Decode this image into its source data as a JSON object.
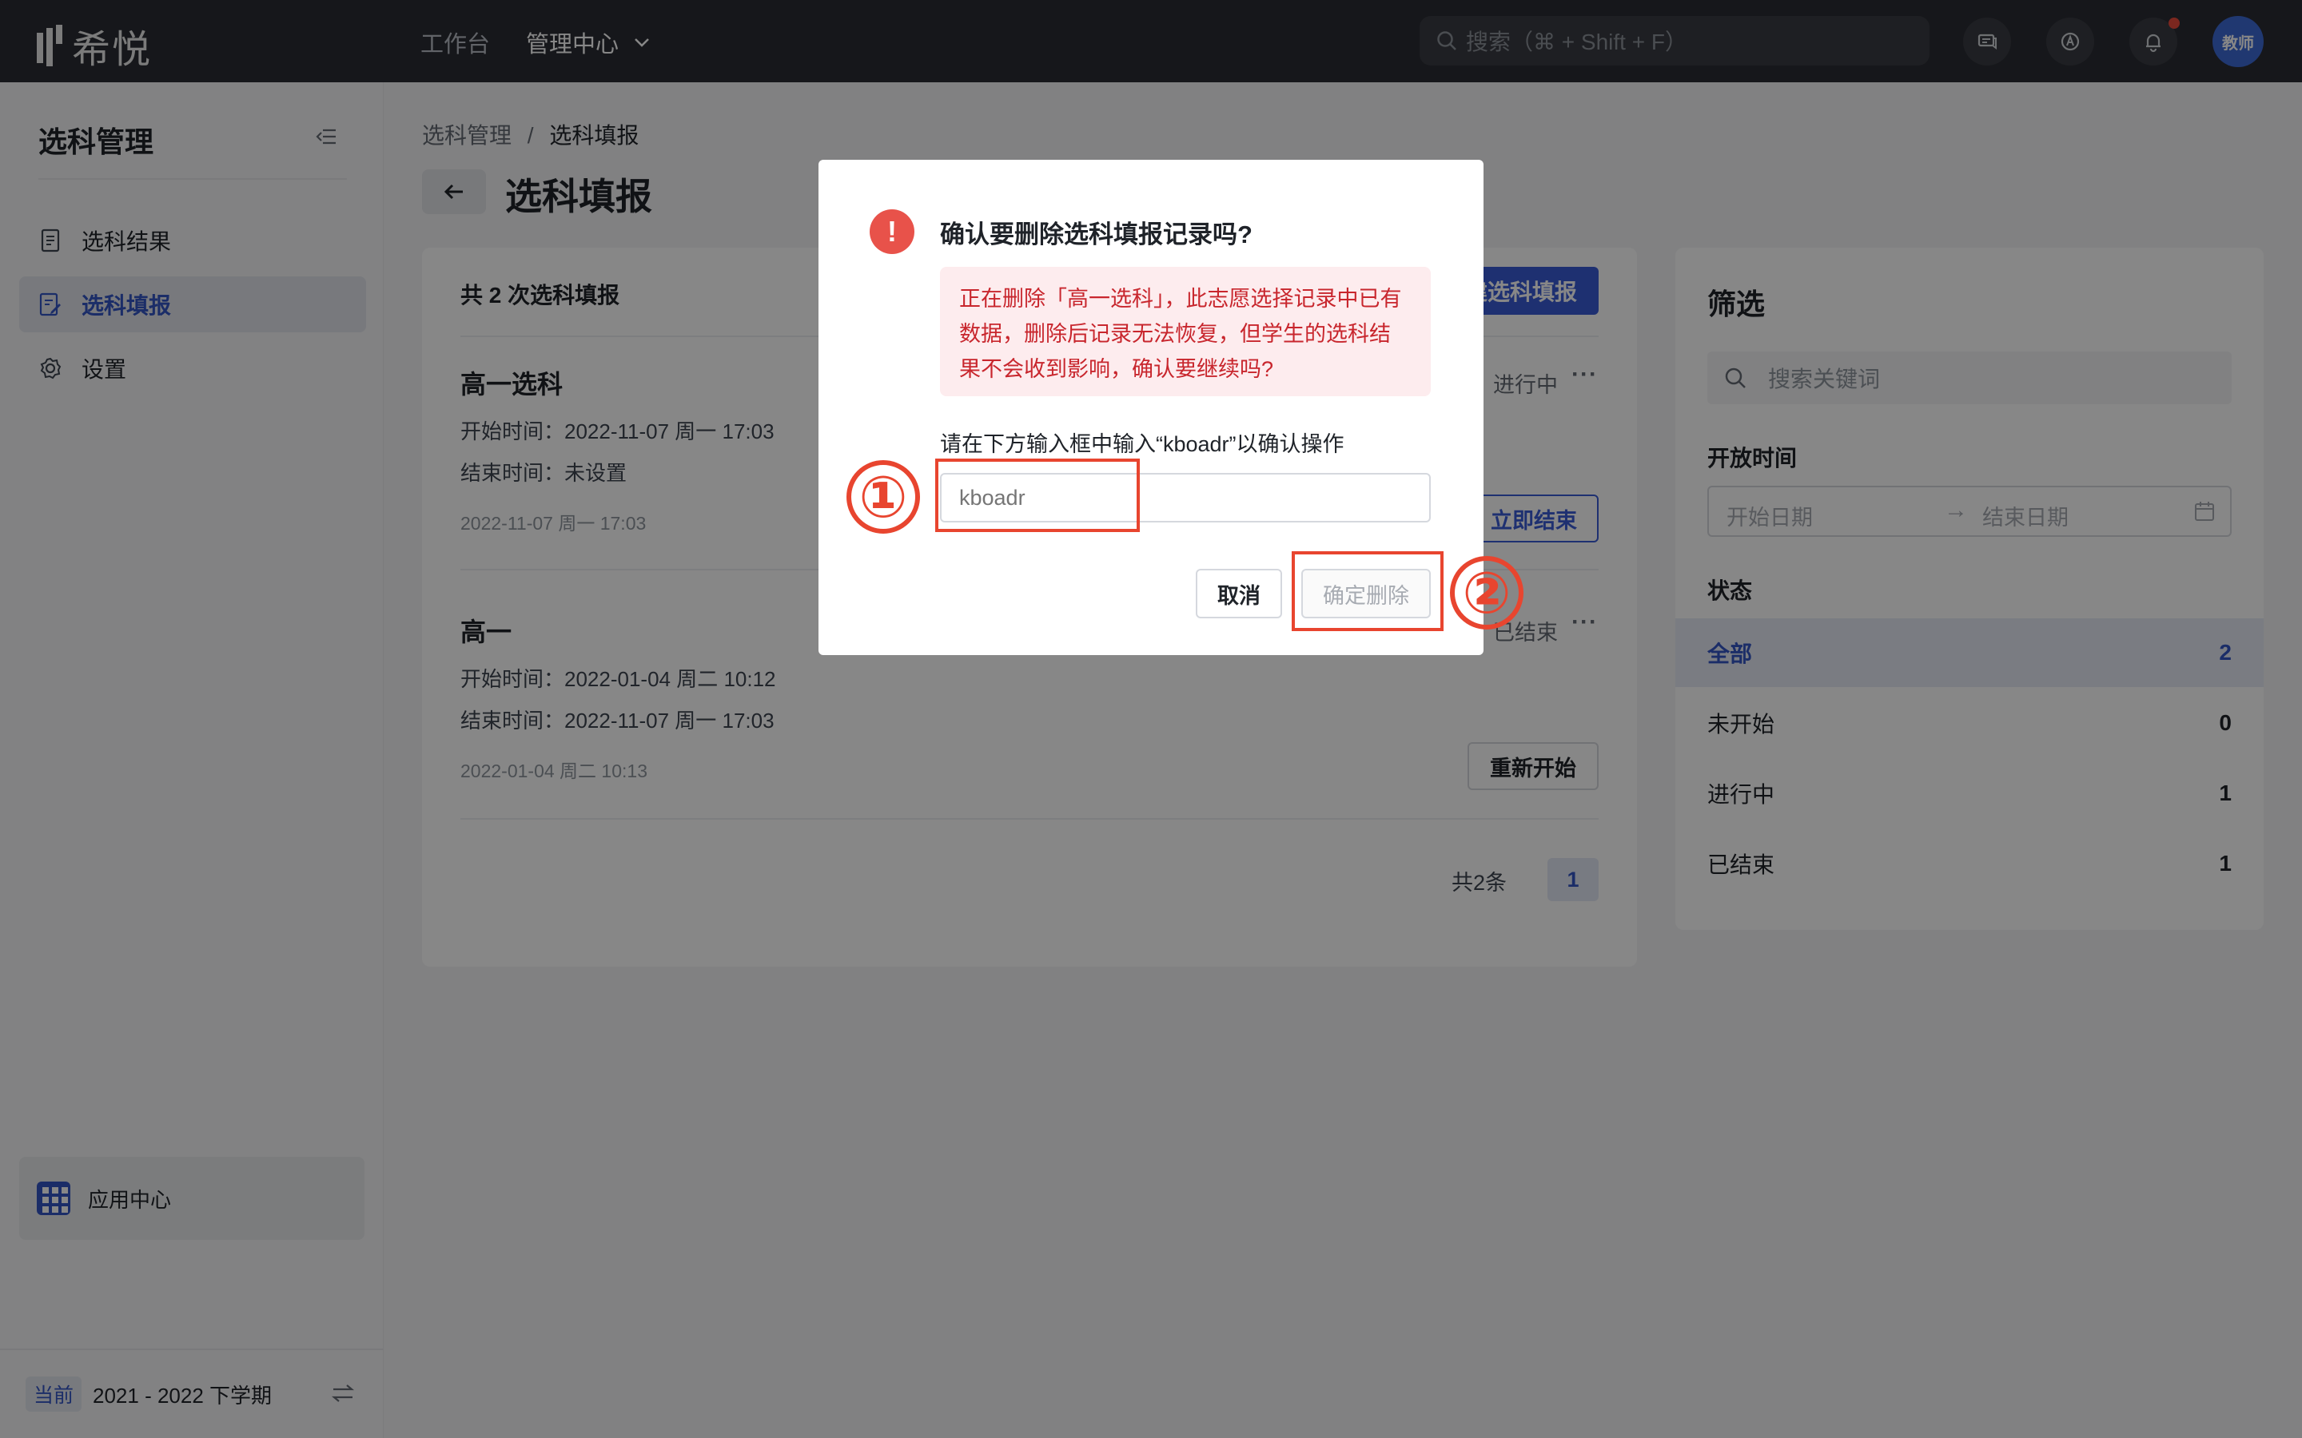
{
  "topbar": {
    "logo_text": "希悦",
    "nav": [
      {
        "label": "工作台"
      },
      {
        "label": "管理中心"
      }
    ],
    "search_placeholder": "搜索（⌘ + Shift + F）",
    "avatar_text": "教师",
    "icons": [
      "chat-icon",
      "app-store-icon",
      "bell-icon"
    ]
  },
  "sidebar": {
    "title": "选科管理",
    "items": [
      {
        "label": "选科结果",
        "icon": "document-icon"
      },
      {
        "label": "选科填报",
        "icon": "edit-document-icon",
        "active": true
      },
      {
        "label": "设置",
        "icon": "gear-icon"
      }
    ],
    "app_center": "应用中心",
    "term_tag": "当前",
    "term_label": "2021 - 2022 下学期"
  },
  "main": {
    "breadcrumb": [
      "选科管理",
      "/",
      "选科填报"
    ],
    "title": "选科填报",
    "list_header": "共 2 次选科填报",
    "new_button": "新建选科填报",
    "records": [
      {
        "title": "高一选科",
        "start": "开始时间：2022-11-07 周一 17:03",
        "end": "结束时间：未设置",
        "created": "2022-11-07 周一 17:03",
        "status": "进行中",
        "action": "立即结束"
      },
      {
        "title": "高一",
        "start": "开始时间：2022-01-04 周二 10:12",
        "end": "结束时间：2022-11-07 周一 17:03",
        "created": "2022-01-04 周二 10:13",
        "status": "已结束",
        "action": "重新开始"
      }
    ],
    "pager": {
      "total": "共2条",
      "page": "1"
    }
  },
  "filter": {
    "title": "筛选",
    "search_placeholder": "搜索关键词",
    "open_time_label": "开放时间",
    "start_placeholder": "开始日期",
    "end_placeholder": "结束日期",
    "status_label": "状态",
    "statuses": [
      {
        "label": "全部",
        "count": "2",
        "active": true
      },
      {
        "label": "未开始",
        "count": "0"
      },
      {
        "label": "进行中",
        "count": "1"
      },
      {
        "label": "已结束",
        "count": "1"
      }
    ]
  },
  "modal": {
    "title": "确认要删除选科填报记录吗?",
    "warning": "正在删除「高一选科」，此志愿选择记录中已有数据，删除后记录无法恢复，但学生的选科结果不会收到影响，确认要继续吗?",
    "hint": "请在下方输入框中输入“kboadr”以确认操作",
    "input_placeholder": "kboadr",
    "cancel": "取消",
    "confirm": "确定删除"
  },
  "annotations": [
    "①",
    "②"
  ],
  "colors": {
    "accent": "#3a5bd6",
    "danger": "#e8524a",
    "annotation": "#e8452f",
    "topbar": "#2b2d33"
  }
}
